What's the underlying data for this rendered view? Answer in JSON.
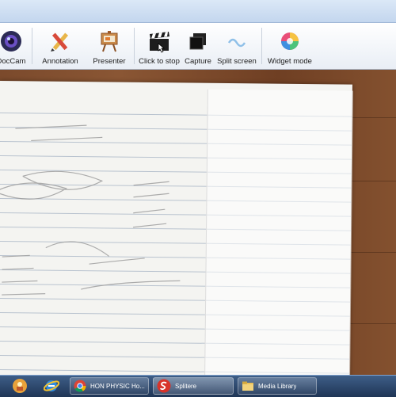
{
  "toolbar": {
    "items": [
      {
        "label": "DocCam",
        "icon": "webcam-lens-icon"
      },
      {
        "label": "Annotation",
        "icon": "pencil-ruler-icon"
      },
      {
        "label": "Presenter",
        "icon": "easel-presenter-icon"
      },
      {
        "label": "Click to stop",
        "icon": "clapperboard-icon"
      },
      {
        "label": "Capture",
        "icon": "photo-stack-icon"
      },
      {
        "label": "Split screen",
        "icon": "split-wave-icon"
      },
      {
        "label": "Widget mode",
        "icon": "color-wheel-icon"
      }
    ]
  },
  "taskbar": {
    "buttons": [
      {
        "label": "HON PHYSIC Ho...",
        "icon": "chrome-icon"
      },
      {
        "label": "Splitere",
        "icon": "app-s-icon"
      },
      {
        "label": "Media Library",
        "icon": "folder-icon"
      }
    ]
  }
}
